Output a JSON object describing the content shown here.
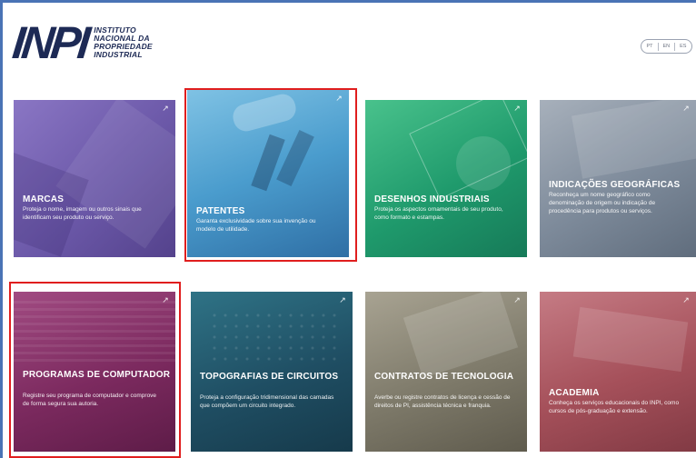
{
  "logo": {
    "mark": "INPI",
    "line1": "INSTITUTO",
    "line2": "NACIONAL DA",
    "line3": "PROPRIEDADE",
    "line4": "INDUSTRIAL"
  },
  "language": {
    "options": [
      "PT",
      "EN",
      "ES"
    ]
  },
  "cards": [
    {
      "title": "MARCAS",
      "description": "Proteja o nome, imagem ou outros sinais que identificam seu produto ou serviço.",
      "color": "#6b58a8"
    },
    {
      "title": "PATENTES",
      "description": "Garanta exclusividade sobre sua invenção ou modelo de utilidade.",
      "color": "#3f8fc2"
    },
    {
      "title": "DESENHOS INDUSTRIAIS",
      "description": "Proteja os aspectos ornamentais de seu produto, como formato e estampas.",
      "color": "#1f9a6c"
    },
    {
      "title": "INDICAÇÕES GEOGRÁFICAS",
      "description": "Reconheça um nome geográfico como denominação de origem ou indicação de procedência para produtos ou serviços.",
      "color": "#7d8a9a"
    },
    {
      "title": "PROGRAMAS DE COMPUTADOR",
      "description": "Registre seu programa de computador e comprove de forma segura sua autoria.",
      "color": "#7c2a5f"
    },
    {
      "title": "TOPOGRAFIAS DE CIRCUITOS",
      "description": "Proteja a configuração tridimensional das camadas que compõem um circuito integrado.",
      "color": "#1f4e63"
    },
    {
      "title": "CONTRATOS DE TECNOLOGIA",
      "description": "Averbe ou registre contratos de licença e cessão de direitos de PI, assistência técnica e franquia.",
      "color": "#7e7a6a"
    },
    {
      "title": "ACADEMIA",
      "description": "Conheça os serviços educacionais do INPI, como cursos de pós-graduação e extensão.",
      "color": "#a5505a"
    }
  ],
  "corner_icon": "↗"
}
